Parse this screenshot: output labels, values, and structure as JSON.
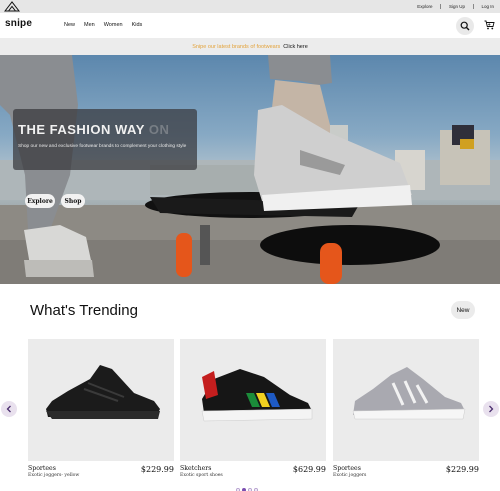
{
  "utility_bar": {
    "links": [
      "Explore",
      "Sign Up",
      "Log In"
    ]
  },
  "nav": {
    "brand": "snipe",
    "links": [
      "New",
      "Men",
      "Women",
      "Kids"
    ],
    "icons": [
      "search-icon",
      "cart-icon"
    ]
  },
  "promo": {
    "message": "Snipe our latest brands of footwears",
    "link": "Click here"
  },
  "hero": {
    "title": "THE FASHION WAY",
    "title_ghost": "ON",
    "subtitle": "Shop our new and exclusive footwear brands to complement your clothing style",
    "explore_label": "Explore",
    "shop_label": "Shop"
  },
  "trending": {
    "title": "What's Trending",
    "filter_label": "New",
    "products": [
      {
        "name": "Sportees",
        "desc": "Exotic joggers- yellow",
        "price": "$229.99"
      },
      {
        "name": "Sketchers",
        "desc": "Exotic sport shoes",
        "price": "$629.99"
      },
      {
        "name": "Sportees",
        "desc": "Exotic joggers",
        "price": "$229.99"
      }
    ],
    "pager": {
      "count": 4,
      "active": 2
    }
  },
  "colors": {
    "promo_accent": "#e3a33c",
    "pager_active": "#7b4fb0",
    "arrow_bg": "#e9e1ee"
  }
}
